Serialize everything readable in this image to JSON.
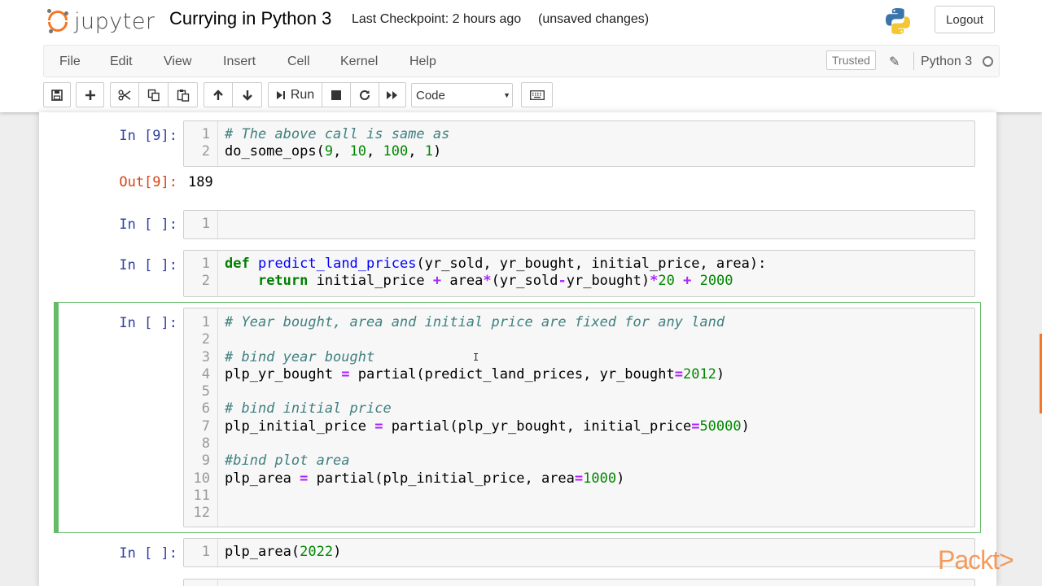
{
  "header": {
    "brand": "jupyter",
    "notebook_title": "Currying in Python 3",
    "checkpoint": "Last Checkpoint: 2 hours ago",
    "autosave_status": "(unsaved changes)",
    "logout_label": "Logout"
  },
  "menubar": {
    "items": [
      "File",
      "Edit",
      "View",
      "Insert",
      "Cell",
      "Kernel",
      "Help"
    ],
    "trusted_label": "Trusted",
    "kernel_name": "Python 3"
  },
  "toolbar": {
    "run_label": "Run",
    "cell_type": "Code"
  },
  "cells": [
    {
      "prompt": "In [9]:",
      "lines": [
        "1",
        "2"
      ],
      "output_prompt": "Out[9]:",
      "output": "189"
    },
    {
      "prompt": "In [ ]:",
      "lines": [
        "1"
      ]
    },
    {
      "prompt": "In [ ]:",
      "lines": [
        "1",
        "2"
      ]
    },
    {
      "prompt": "In [ ]:",
      "lines": [
        "1",
        "2",
        "3",
        "4",
        "5",
        "6",
        "7",
        "8",
        "9",
        "10",
        "11",
        "12"
      ]
    },
    {
      "prompt": "In [ ]:",
      "lines": [
        "1"
      ]
    }
  ],
  "code": {
    "c1_l1": "# The above call is same as",
    "c1_l2_fn": "do_some_ops(",
    "c1_l2_a": "9",
    "c1_l2_b": "10",
    "c1_l2_c": "100",
    "c1_l2_d": "1",
    "c3_l1_def": "def",
    "c3_l1_name": "predict_land_prices",
    "c3_l1_args": "(yr_sold, yr_bought, initial_price, area):",
    "c3_l2_ret": "return",
    "c3_l2_a": " initial_price ",
    "c3_l2_b": " area",
    "c3_l2_c": "(yr_sold",
    "c3_l2_d": "yr_bought)",
    "c3_l2_n1": "20",
    "c3_l2_n2": "2000",
    "c4_l1": "# Year bought, area and initial price are fixed for any land",
    "c4_l3": "# bind year bought",
    "c4_l4_a": "plp_yr_bought ",
    "c4_l4_b": " partial(predict_land_prices, yr_bought",
    "c4_l4_n": "2012",
    "c4_l6": "# bind initial price",
    "c4_l7_a": "plp_initial_price ",
    "c4_l7_b": " partial(plp_yr_bought, initial_price",
    "c4_l7_n": "50000",
    "c4_l9": "#bind plot area",
    "c4_l10_a": "plp_area ",
    "c4_l10_b": " partial(plp_initial_price, area",
    "c4_l10_n": "1000",
    "c5_l1_fn": "plp_area(",
    "c5_l1_n": "2022"
  },
  "watermark": "Packt>",
  "colors": {
    "accent_orange": "#f37726",
    "selected_cell": "#66bb6a",
    "prompt_in": "#303f9f",
    "prompt_out": "#d84315"
  }
}
